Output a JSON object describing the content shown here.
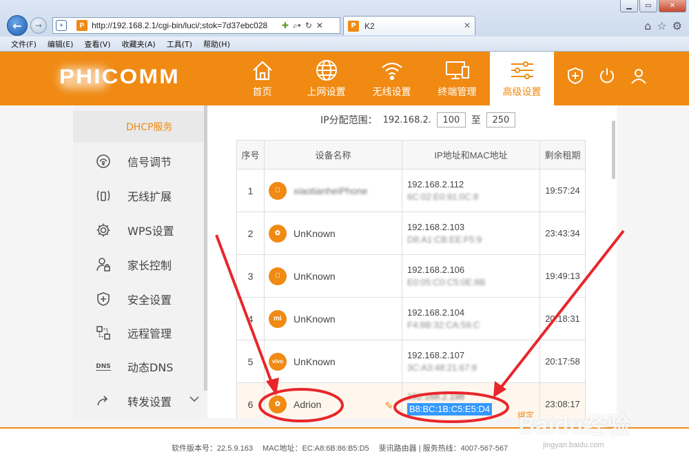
{
  "browser": {
    "url": "http://192.168.2.1/cgi-bin/luci/;stok=7d37ebc028",
    "tab_title": "K2",
    "menu": [
      "文件(F)",
      "编辑(E)",
      "查看(V)",
      "收藏夹(A)",
      "工具(T)",
      "帮助(H)"
    ]
  },
  "header": {
    "logo": "PHICOMM",
    "nav": [
      {
        "label": "首页",
        "icon": "home-icon"
      },
      {
        "label": "上网设置",
        "icon": "globe-icon"
      },
      {
        "label": "无线设置",
        "icon": "wifi-icon"
      },
      {
        "label": "终端管理",
        "icon": "devices-icon"
      },
      {
        "label": "高级设置",
        "icon": "sliders-icon",
        "active": true
      }
    ],
    "icons": [
      "shield-plus-icon",
      "power-icon",
      "user-icon"
    ],
    "accent_color": "#f08a13"
  },
  "sidebar": {
    "items": [
      {
        "label": "DHCP服务",
        "icon": "",
        "active": true
      },
      {
        "label": "信号调节",
        "icon": "signal-icon"
      },
      {
        "label": "无线扩展",
        "icon": "extender-icon"
      },
      {
        "label": "WPS设置",
        "icon": "gear-icon"
      },
      {
        "label": "家长控制",
        "icon": "parental-icon"
      },
      {
        "label": "安全设置",
        "icon": "shield-icon"
      },
      {
        "label": "远程管理",
        "icon": "remote-icon"
      },
      {
        "label": "动态DNS",
        "icon": "dns-icon"
      },
      {
        "label": "转发设置",
        "icon": "forward-icon"
      }
    ],
    "dns_badge": "DNS",
    "expand_icon": "chevron-down-icon"
  },
  "dhcp": {
    "range_label": "IP分配范围：",
    "range_prefix": "192.168.2.",
    "range_start": "100",
    "range_to": "至",
    "range_end": "250"
  },
  "table": {
    "headers": [
      "序号",
      "设备名称",
      "IP地址和MAC地址",
      "剩余租期"
    ],
    "rows": [
      {
        "index": "1",
        "brand": "apple",
        "name": "xiaotianheiPhone",
        "name_blurred": true,
        "ip": "192.168.2.112",
        "mac": "6C:02:E0:91:0C:8",
        "lease": "19:57:24"
      },
      {
        "index": "2",
        "brand": "huawei",
        "name": "UnKnown",
        "ip": "192.168.2.103",
        "mac": "D8:A1:CB:EE:F5:9",
        "lease": "23:43:34"
      },
      {
        "index": "3",
        "brand": "apple",
        "name": "UnKnown",
        "ip": "192.168.2.106",
        "mac": "E0:05:C0:C5:0E:8B",
        "lease": "19:49:13"
      },
      {
        "index": "4",
        "brand": "mi",
        "name": "UnKnown",
        "ip": "192.168.2.104",
        "mac": "F4:8B:32:CA:59:C",
        "lease": "20:18:31"
      },
      {
        "index": "5",
        "brand": "vivo",
        "name": "UnKnown",
        "ip": "192.168.2.107",
        "mac": "3C:A3:48:21:67:8",
        "lease": "20:17:58"
      },
      {
        "index": "6",
        "brand": "huawei",
        "name": "Adrion",
        "ip": "192.168.2.198",
        "mac": "B8:BC:1B:C5:E5:D4",
        "lease": "23:08:17",
        "bind": "绑定",
        "selected": true
      }
    ]
  },
  "footer": {
    "version": "软件版本号：22.5.9.163",
    "mac": "MAC地址：EC:A8:6B:86:B5:D5",
    "company": "斐讯路由器 | 服务热线：4007-567-567"
  },
  "watermark": {
    "text": "Baidu经验",
    "sub": "jingyan.baidu.com"
  }
}
